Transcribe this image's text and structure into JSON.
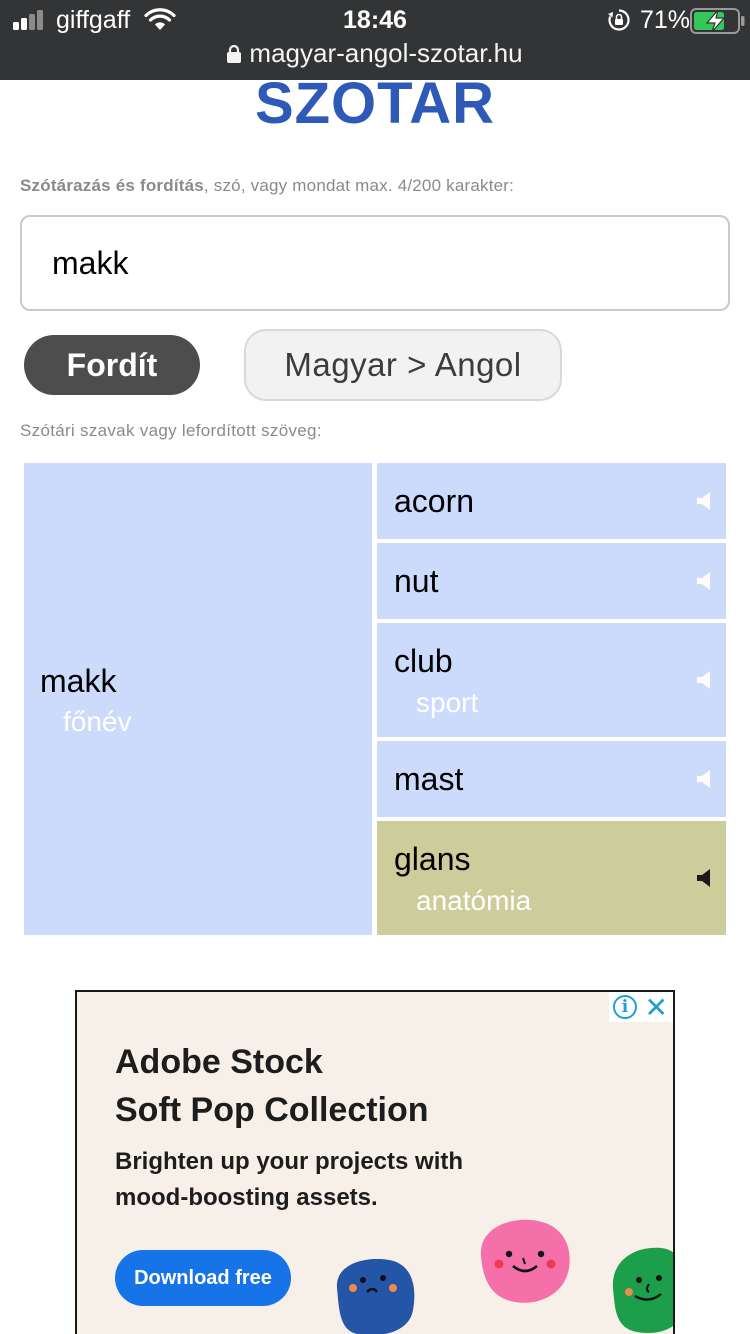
{
  "status_bar": {
    "carrier": "giffgaff",
    "time": "18:46",
    "battery_percent": "71%",
    "battery_level": 0.71
  },
  "browser": {
    "url": "magyar-angol-szotar.hu"
  },
  "page": {
    "logo": "SZOTAR",
    "hint_bold": "Szótárazás és fordítás",
    "hint_rest": ", szó, vagy mondat max. 4/200 karakter:",
    "query_value": "makk",
    "translate_button": "Fordít",
    "direction_button": "Magyar > Angol",
    "results_label": "Szótári szavak vagy lefordított szöveg:"
  },
  "results": {
    "source_word": "makk",
    "source_pos": "főnév",
    "translations": [
      {
        "word": "acorn",
        "note": ""
      },
      {
        "word": "nut",
        "note": ""
      },
      {
        "word": "club",
        "note": "sport"
      },
      {
        "word": "mast",
        "note": ""
      },
      {
        "word": "glans",
        "note": "anatómia"
      }
    ]
  },
  "ad": {
    "headline_1": "Adobe Stock",
    "headline_2": "Soft Pop Collection",
    "body_1": "Brighten up your projects with",
    "body_2": "mood-boosting assets.",
    "cta": "Download free",
    "info_icon": "i",
    "close_icon": "✕"
  },
  "colors": {
    "logo": "#2e59b6",
    "cell_blue": "#ccdbfb",
    "cell_olive": "#cdcd9c",
    "ad_cta": "#1773e8"
  }
}
